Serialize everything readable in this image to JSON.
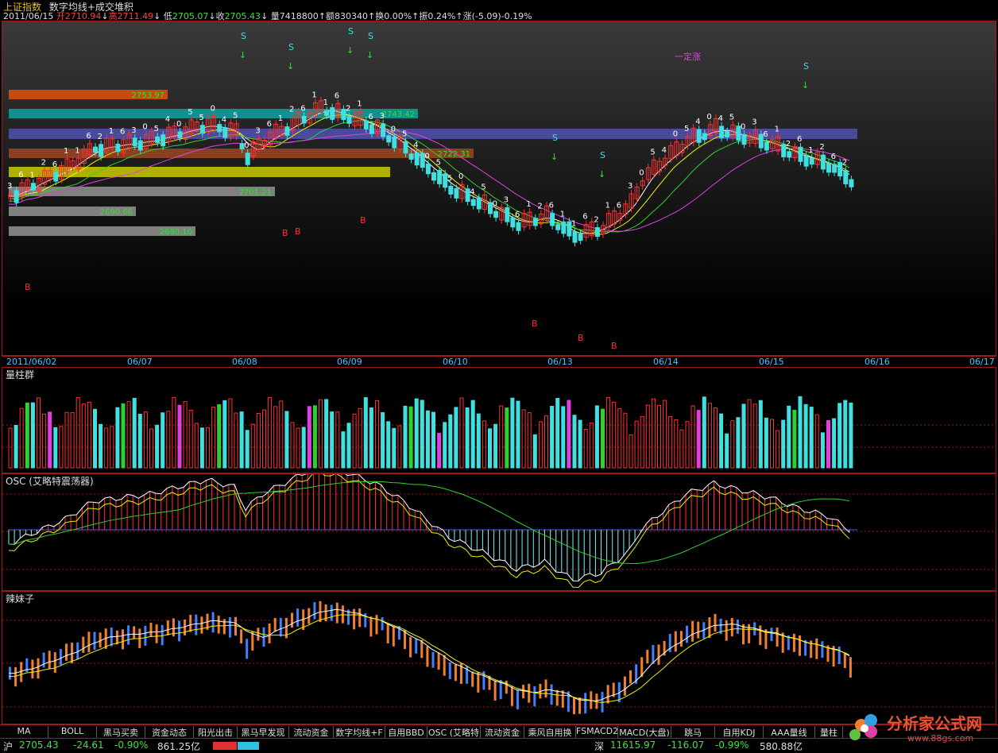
{
  "header": {
    "index_name": "上证指数",
    "formula": "数字均线+成交堆积",
    "date": "2011/06/15",
    "open_label": "开",
    "open": "2710.94",
    "high_label": "高",
    "high": "2711.49",
    "low_label": "低",
    "low": "2705.07",
    "close_label": "收",
    "close": "2705.43",
    "volume_label": "量",
    "volume": "7418800",
    "amount_label": "额",
    "amount": "830340",
    "turnover_label": "换",
    "turnover": "0.00%",
    "amplitude_label": "振",
    "amplitude": "0.24%",
    "change_label": "涨",
    "change": "(-5.09)-0.19%"
  },
  "colors": {
    "up": "#ff3030",
    "down": "#40e0e0",
    "yellow": "#f0f000",
    "magenta": "#e040e0",
    "green": "#30d030",
    "grid": "#a01818"
  },
  "main_chart": {
    "levels": [
      {
        "value": "2753.97",
        "color": "#c84a10"
      },
      {
        "value": "2743.42",
        "color": "#109090"
      },
      {
        "value": "2722.31",
        "color": "#8a4020"
      },
      {
        "value": "2701.21",
        "color": "#808080"
      },
      {
        "value": "2690.66",
        "color": "#808080"
      },
      {
        "value": "2680.10",
        "color": "#808080"
      }
    ],
    "annotation_text": "一定涨"
  },
  "dates": [
    "2011/06/02",
    "06/07",
    "06/08",
    "06/09",
    "06/10",
    "06/13",
    "06/14",
    "06/15",
    "06/16",
    "06/17"
  ],
  "panels": {
    "volume_title": "量柱群",
    "osc_title": "OSC (艾略特震荡器)",
    "lmz_title": "辣妹子"
  },
  "tabs": [
    "MA",
    "BOLL",
    "黑马买卖",
    "资金动态",
    "阳光出击",
    "黑马早发现",
    "流动资金",
    "数字均线+F",
    "自用BBD",
    "OSC (艾略特",
    "流动资金",
    "乘风自用换",
    "FSMACD2",
    "MACD(大盘)",
    "跳马",
    "自用KDJ",
    "AAA量线",
    "量柱"
  ],
  "status": {
    "sh_label": "沪",
    "sh_index": "2705.43",
    "sh_change": "-24.61",
    "sh_pct": "-0.90%",
    "sh_amount": "861.25亿",
    "sz_label": "深",
    "sz_index": "11615.97",
    "sz_change": "-116.07",
    "sz_pct": "-0.99%",
    "sz_amount": "580.88亿"
  },
  "watermark": {
    "name": "分析家公式网",
    "url": "www.88gs.com"
  }
}
